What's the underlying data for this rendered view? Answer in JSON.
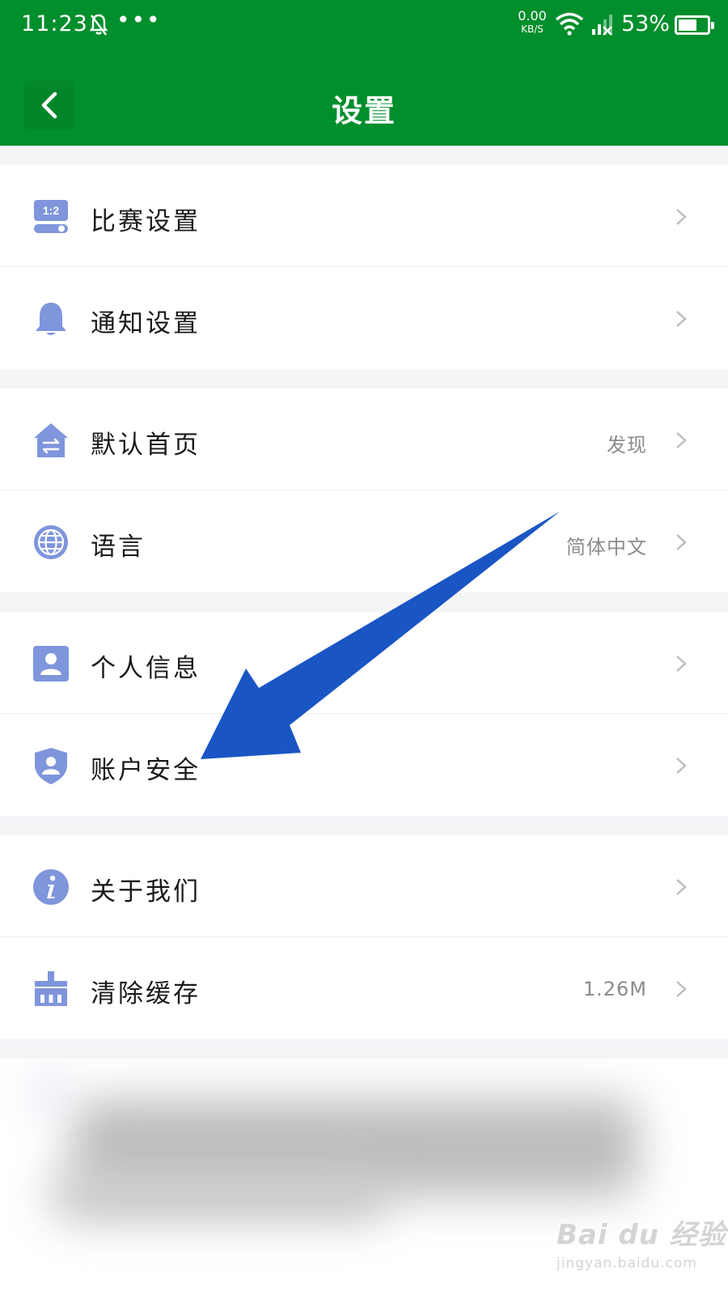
{
  "status_bar": {
    "time": "11:23",
    "net_speed_value": "0.00",
    "net_speed_unit": "KB/S",
    "battery": "53%",
    "icons": [
      "bell-muted-icon",
      "more-dots-icon",
      "wifi-icon",
      "signal-icon",
      "battery-icon"
    ]
  },
  "header": {
    "title": "设置",
    "back_icon": "chevron-left-icon"
  },
  "settings": [
    {
      "label": "比赛设置",
      "icon": "match-score-icon",
      "value": ""
    },
    {
      "label": "通知设置",
      "icon": "bell-icon",
      "value": ""
    },
    {
      "label": "默认首页",
      "icon": "home-swap-icon",
      "value": "发现"
    },
    {
      "label": "语言",
      "icon": "globe-icon",
      "value": "简体中文"
    },
    {
      "label": "个人信息",
      "icon": "profile-card-icon",
      "value": ""
    },
    {
      "label": "账户安全",
      "icon": "shield-user-icon",
      "value": ""
    },
    {
      "label": "关于我们",
      "icon": "info-icon",
      "value": ""
    },
    {
      "label": "清除缓存",
      "icon": "broom-icon",
      "value": "1.26M"
    }
  ],
  "watermark": {
    "brand": "Bai du 经验",
    "site": "jingyan.baidu.com"
  },
  "colors": {
    "header_green": "#018e2c",
    "icon_blue": "#7f95dc",
    "arrow_blue": "#1a55c4"
  }
}
